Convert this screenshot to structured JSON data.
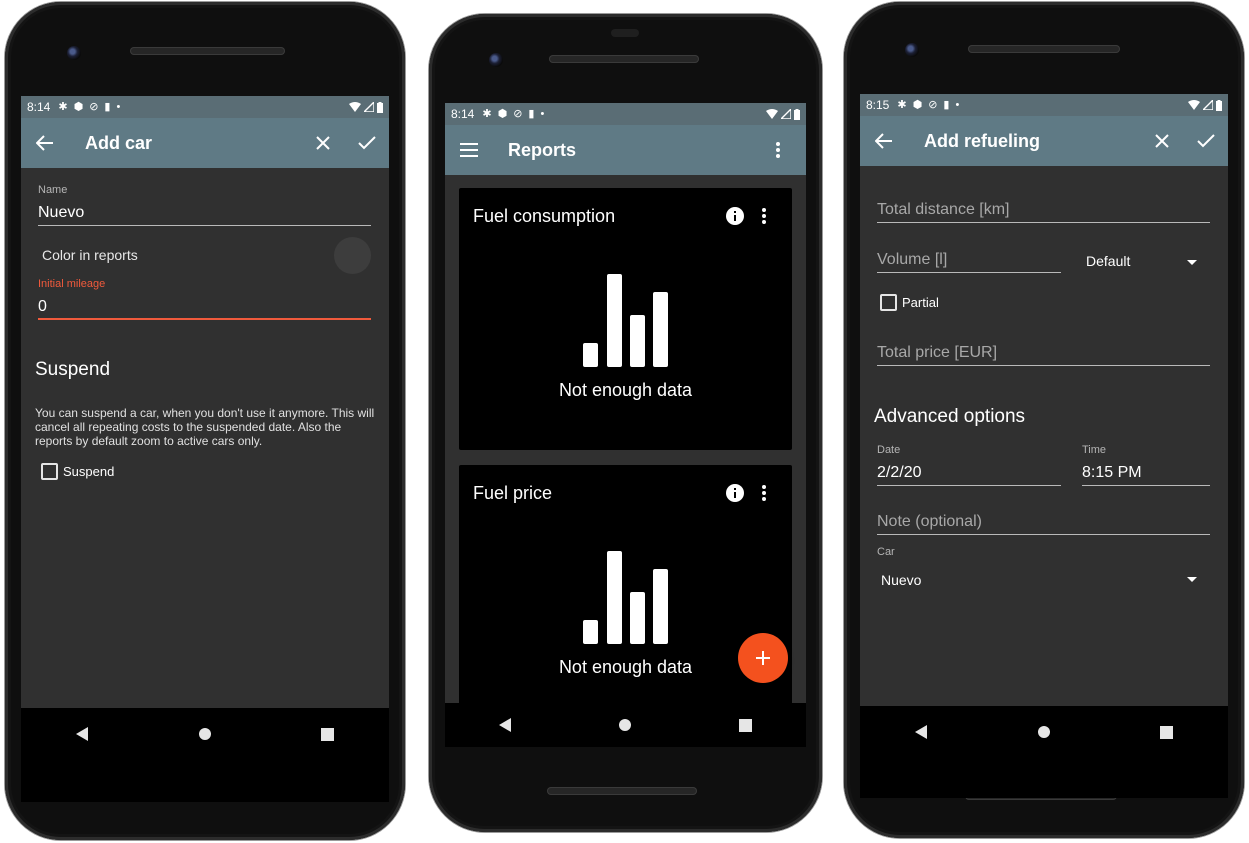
{
  "colors": {
    "status_bar": "#5a6d75",
    "app_bar": "#5f7a85",
    "screen_bg": "#303030",
    "accent": "#f4511e",
    "error_red": "#f05a3c",
    "card_bg": "#000000"
  },
  "screens": [
    {
      "status": {
        "time": "8:14",
        "left_icons": [
          "gear-icon",
          "shield-icon",
          "do-not-disturb-icon",
          "sd-card-icon",
          "dot-icon"
        ],
        "right_icons": [
          "wifi-icon",
          "signal-icon",
          "battery-icon"
        ]
      },
      "appbar": {
        "title": "Add car",
        "nav_icon": "arrow-back-icon",
        "actions": [
          "close-icon",
          "check-icon"
        ]
      },
      "form": {
        "name_label": "Name",
        "name_value": "Nuevo",
        "color_label": "Color in reports",
        "initial_mileage_label": "Initial mileage",
        "initial_mileage_value": "0",
        "suspend_heading": "Suspend",
        "suspend_description": "You can suspend a car, when you don't use it anymore. This will cancel all repeating costs to the suspended date. Also the reports by default zoom to active cars only.",
        "suspend_checkbox_label": "Suspend"
      }
    },
    {
      "status": {
        "time": "8:14",
        "left_icons": [
          "gear-icon",
          "shield-icon",
          "do-not-disturb-icon",
          "sd-card-icon",
          "dot-icon"
        ],
        "right_icons": [
          "wifi-icon",
          "signal-icon",
          "battery-icon"
        ]
      },
      "appbar": {
        "title": "Reports",
        "nav_icon": "menu-icon",
        "actions": [
          "more-vert-icon"
        ]
      },
      "cards": [
        {
          "title": "Fuel consumption",
          "empty_text": "Not enough data",
          "icons": [
            "info-icon",
            "more-vert-icon"
          ]
        },
        {
          "title": "Fuel price",
          "empty_text": "Not enough data",
          "icons": [
            "info-icon",
            "more-vert-icon"
          ]
        }
      ],
      "fab_icon": "plus-icon"
    },
    {
      "status": {
        "time": "8:15",
        "left_icons": [
          "gear-icon",
          "shield-icon",
          "do-not-disturb-icon",
          "sd-card-icon",
          "dot-icon"
        ],
        "right_icons": [
          "wifi-icon",
          "signal-icon",
          "battery-icon"
        ]
      },
      "appbar": {
        "title": "Add refueling",
        "nav_icon": "arrow-back-icon",
        "actions": [
          "close-icon",
          "check-icon"
        ]
      },
      "form": {
        "total_distance_hint": "Total distance [km]",
        "volume_hint": "Volume [l]",
        "fuel_type_value": "Default",
        "partial_label": "Partial",
        "total_price_hint": "Total price [EUR]",
        "advanced_heading": "Advanced options",
        "date_label": "Date",
        "date_value": "2/2/20",
        "time_label": "Time",
        "time_value": "8:15 PM",
        "note_hint": "Note (optional)",
        "car_label": "Car",
        "car_value": "Nuevo"
      }
    }
  ]
}
